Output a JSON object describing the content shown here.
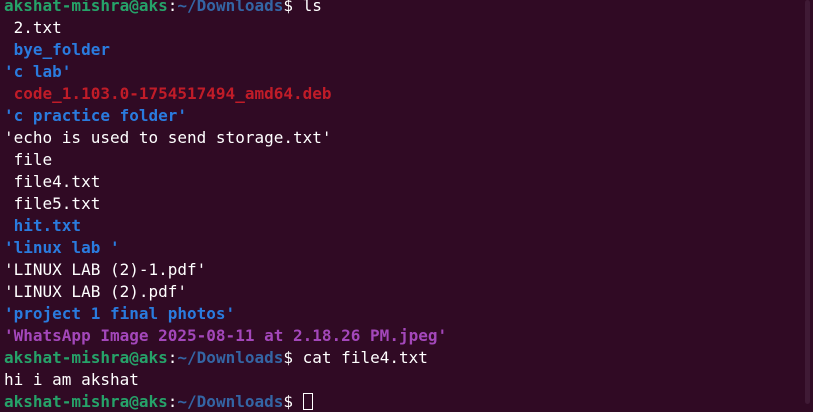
{
  "prompt": {
    "user_host": "akshat-mishra@aks",
    "colon": ":",
    "path": "~/Downloads",
    "dollar": "$"
  },
  "commands": {
    "ls": " ls",
    "cat": " cat file4.txt",
    "current": " "
  },
  "ls_output": {
    "item_1": " 2.txt",
    "item_2": " bye_folder",
    "item_3": "'c lab'",
    "item_4": " code_1.103.0-1754517494_amd64.deb",
    "item_5": "'c practice folder'",
    "item_6": "'echo is used to send storage.txt'",
    "item_7": " file",
    "item_8": " file4.txt",
    "item_9": " file5.txt",
    "item_10": " hit.txt",
    "item_11": "'linux lab '",
    "item_12": "'LINUX LAB (2)-1.pdf'",
    "item_13": "'LINUX LAB (2).pdf'",
    "item_14": "'project 1 final photos'",
    "item_15": "'WhatsApp Image 2025-08-11 at 2.18.26 PM.jpeg'"
  },
  "cat_output": "hi i am akshat",
  "colors": {
    "background": "#300a24",
    "prompt_user": "#26a269",
    "prompt_path": "#3465a4",
    "directory": "#2a7bde",
    "archive": "#c01c28",
    "image": "#a347ba",
    "text": "#ffffff"
  }
}
